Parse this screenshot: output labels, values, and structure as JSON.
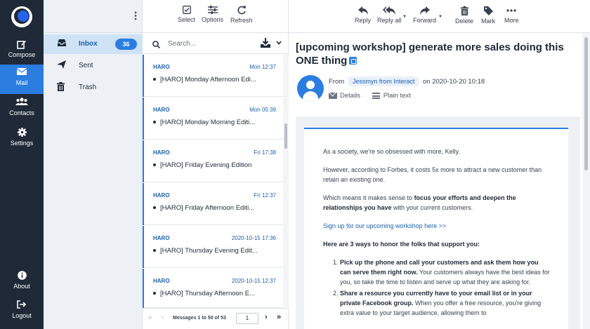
{
  "rail": {
    "items": [
      {
        "label": "Compose",
        "icon": "compose-icon"
      },
      {
        "label": "Mail",
        "icon": "envelope-icon"
      },
      {
        "label": "Contacts",
        "icon": "contacts-icon"
      },
      {
        "label": "Settings",
        "icon": "gear-icon"
      }
    ],
    "bottom": [
      {
        "label": "About",
        "icon": "info-icon"
      },
      {
        "label": "Logout",
        "icon": "logout-icon"
      }
    ],
    "active_color": "#2b7de0"
  },
  "folders": {
    "items": [
      {
        "label": "Inbox",
        "count": "36",
        "icon": "inbox-icon"
      },
      {
        "label": "Sent",
        "icon": "paper-plane-icon"
      },
      {
        "label": "Trash",
        "icon": "trash-icon"
      }
    ]
  },
  "list_toolbar": {
    "select_label": "Select",
    "options_label": "Options",
    "refresh_label": "Refresh"
  },
  "search": {
    "placeholder": "Search...",
    "value": ""
  },
  "messages": [
    {
      "from": "HARO",
      "date": "Mon 12:37",
      "subject": "[HARO] Monday Afternoon Edi..."
    },
    {
      "from": "HARO",
      "date": "Mon 05:39",
      "subject": "[HARO] Monday Morning Editi..."
    },
    {
      "from": "HARO",
      "date": "Fri 17:38",
      "subject": "[HARO] Friday Evening Edition"
    },
    {
      "from": "HARO",
      "date": "Fri 12:37",
      "subject": "[HARO] Friday Afternoon Editi..."
    },
    {
      "from": "HARO",
      "date": "2020-10-15 17:36",
      "subject": "[HARO] Thursday Evening Edit..."
    },
    {
      "from": "HARO",
      "date": "2020-10-15 12:37",
      "subject": "[HARO] Thursday Afternoon E..."
    }
  ],
  "pager": {
    "info": "Messages 1 to 50 of 53",
    "page": "1"
  },
  "reader_toolbar": {
    "reply_label": "Reply",
    "reply_all_label": "Reply all",
    "forward_label": "Forward",
    "delete_label": "Delete",
    "mark_label": "Mark",
    "more_label": "More"
  },
  "message": {
    "subject": "[upcoming workshop] generate more sales doing this ONE thing",
    "from_prefix": "From",
    "sender": "Jessmyn from Interact",
    "date_text": "on 2020-10-20 10:18",
    "details_label": "Details",
    "plain_text_label": "Plain text",
    "body": {
      "p1": "As a society, we're so obsessed with more, Kelly.",
      "p2": "However, according to Forbes, it costs 5x more to attract a new customer than retain an existing one.",
      "p3_start": "Which means it makes sense to ",
      "p3_bold": "focus your efforts and deepen the relationships you have",
      "p3_end": " with your current customers.",
      "link": "Sign up for our upcoming workshop here >>",
      "heading": "Here are 3 ways to honor the folks that support you:",
      "li1_bold": "Pick up the phone and call your customers and ask them how you can serve them right now.",
      "li1_text": " Your customers always have the best ideas for you, so take the time to listen and serve up what they are asking for.",
      "li2_bold": "Share a resource you currently have to your email list or in your private Facebook group.",
      "li2_text": " When you offer a free resource, you're giving extra value to your target audience, allowing them to"
    }
  },
  "colors": {
    "rail_bg": "#1f2937",
    "accent": "#2b7de0",
    "folder_bg": "#edf1f6",
    "link": "#1c5fb0"
  }
}
